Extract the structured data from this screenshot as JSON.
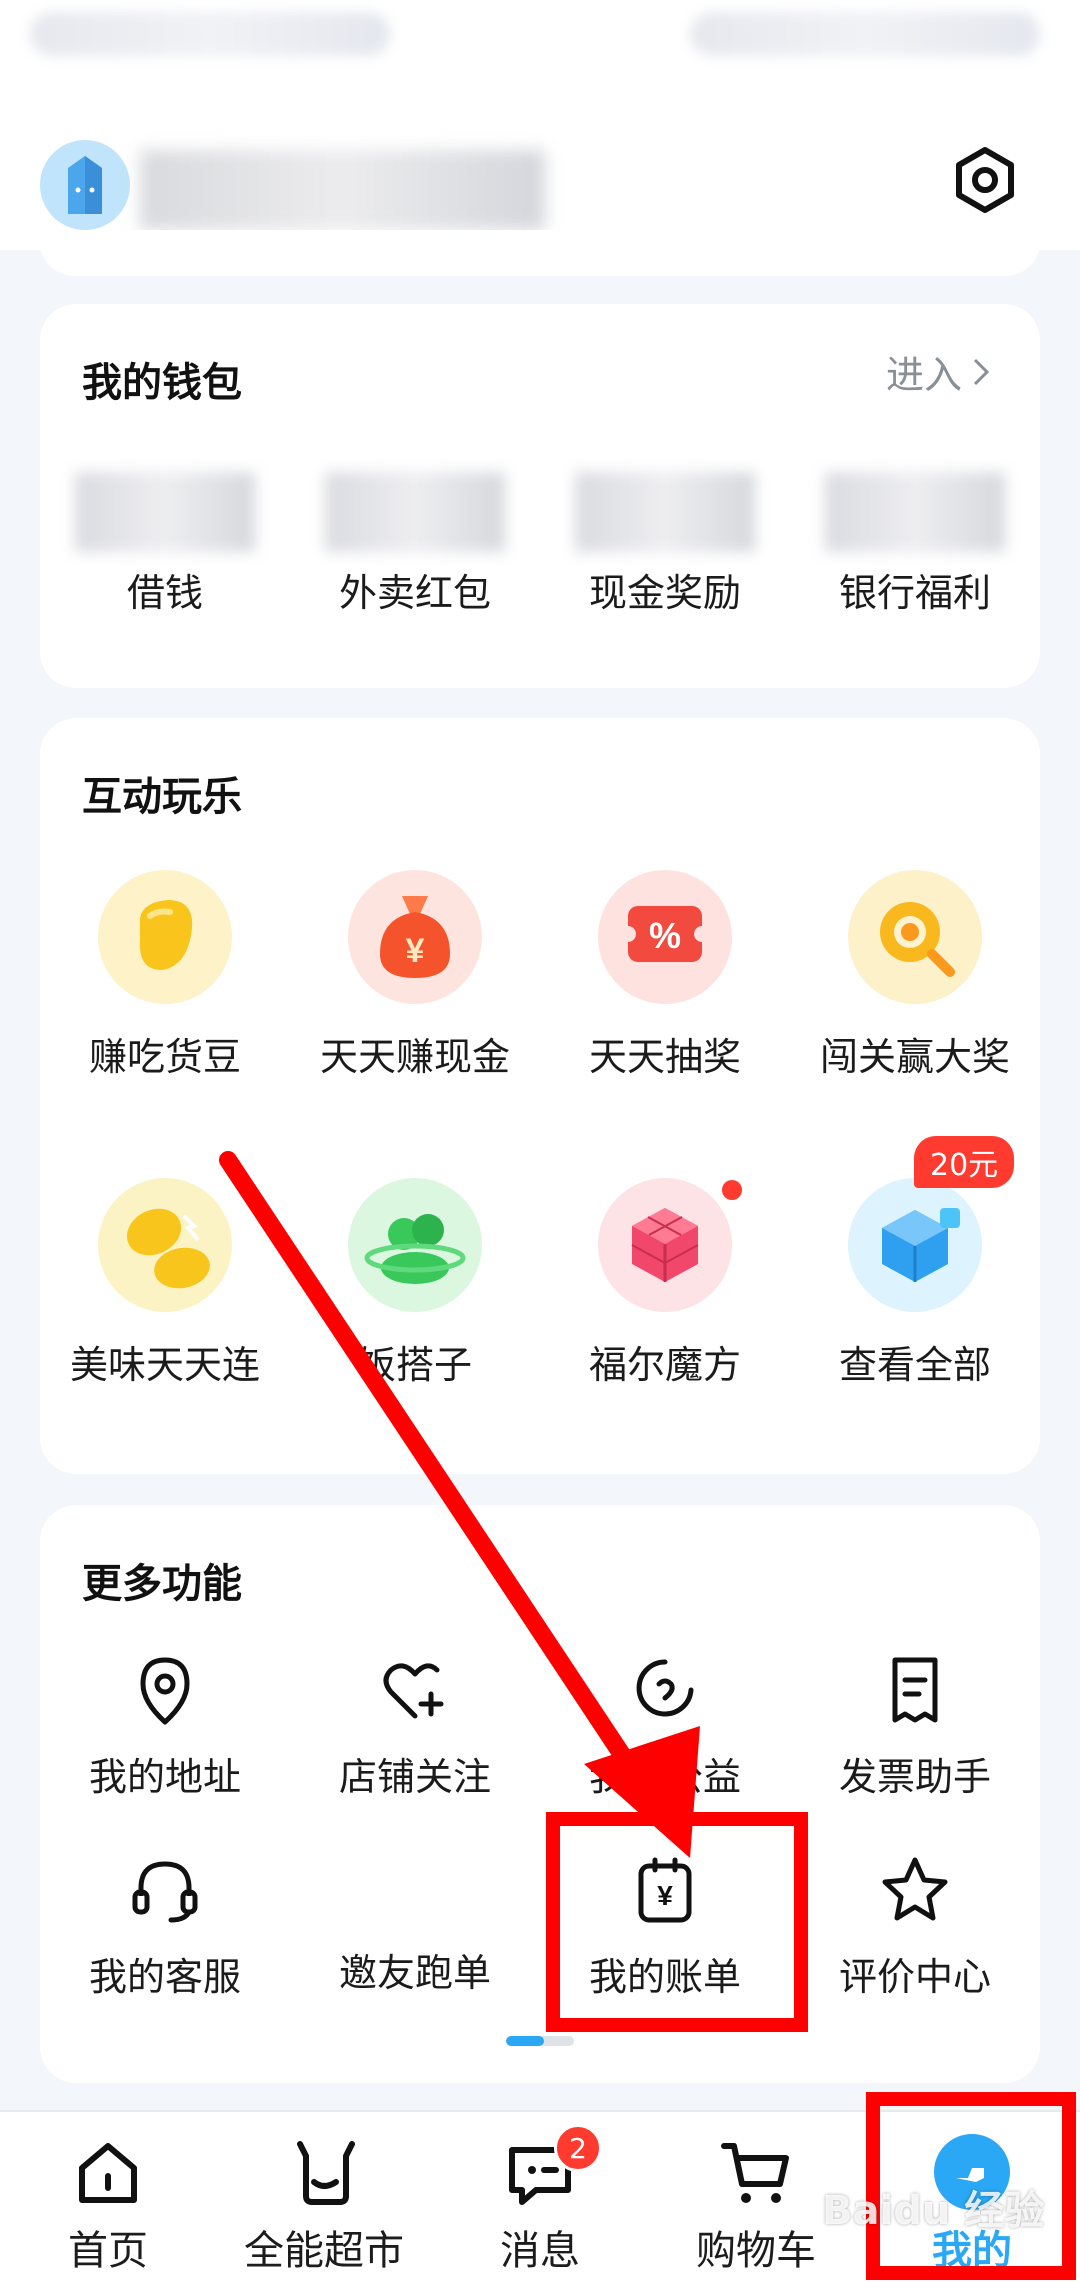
{
  "header": {
    "avatar": "milk-carton-avatar-icon",
    "settings": "settings-hexagon-icon"
  },
  "wallet": {
    "title": "我的钱包",
    "enter_label": "进入",
    "items": [
      {
        "label": "借钱"
      },
      {
        "label": "外卖红包"
      },
      {
        "label": "现金奖励"
      },
      {
        "label": "银行福利"
      }
    ]
  },
  "games": {
    "title": "互动玩乐",
    "items": [
      {
        "label": "赚吃货豆",
        "icon": "bean-icon"
      },
      {
        "label": "天天赚现金",
        "icon": "money-bag-icon"
      },
      {
        "label": "天天抽奖",
        "icon": "coupon-icon"
      },
      {
        "label": "闯关赢大奖",
        "icon": "magnifier-icon"
      },
      {
        "label": "美味天天连",
        "icon": "lemon-icon"
      },
      {
        "label": "饭搭子",
        "icon": "people-planet-icon"
      },
      {
        "label": "福尔魔方",
        "icon": "cube-icon"
      },
      {
        "label": "查看全部",
        "icon": "all-cube-icon",
        "badge": "20元"
      }
    ]
  },
  "more": {
    "title": "更多功能",
    "items": [
      {
        "label": "我的地址",
        "icon": "location-icon"
      },
      {
        "label": "店铺关注",
        "icon": "heart-plus-icon"
      },
      {
        "label": "我的公益",
        "icon": "charity-icon"
      },
      {
        "label": "发票助手",
        "icon": "invoice-icon"
      },
      {
        "label": "我的客服",
        "icon": "headset-icon"
      },
      {
        "label": "邀友跑单",
        "icon": ""
      },
      {
        "label": "我的账单",
        "icon": "bill-icon"
      },
      {
        "label": "评价中心",
        "icon": "star-icon"
      }
    ]
  },
  "tabbar": {
    "items": [
      {
        "label": "首页",
        "icon": "home-icon"
      },
      {
        "label": "全能超市",
        "icon": "supermarket-icon"
      },
      {
        "label": "消息",
        "icon": "message-icon",
        "badge": "2"
      },
      {
        "label": "购物车",
        "icon": "cart-icon"
      },
      {
        "label": "我的",
        "icon": "profile-icon"
      }
    ]
  },
  "watermark": "Baidu 经验",
  "colors": {
    "accent": "#2aa8f5",
    "highlight": "#ff0000",
    "badge": "#ff3b30"
  }
}
